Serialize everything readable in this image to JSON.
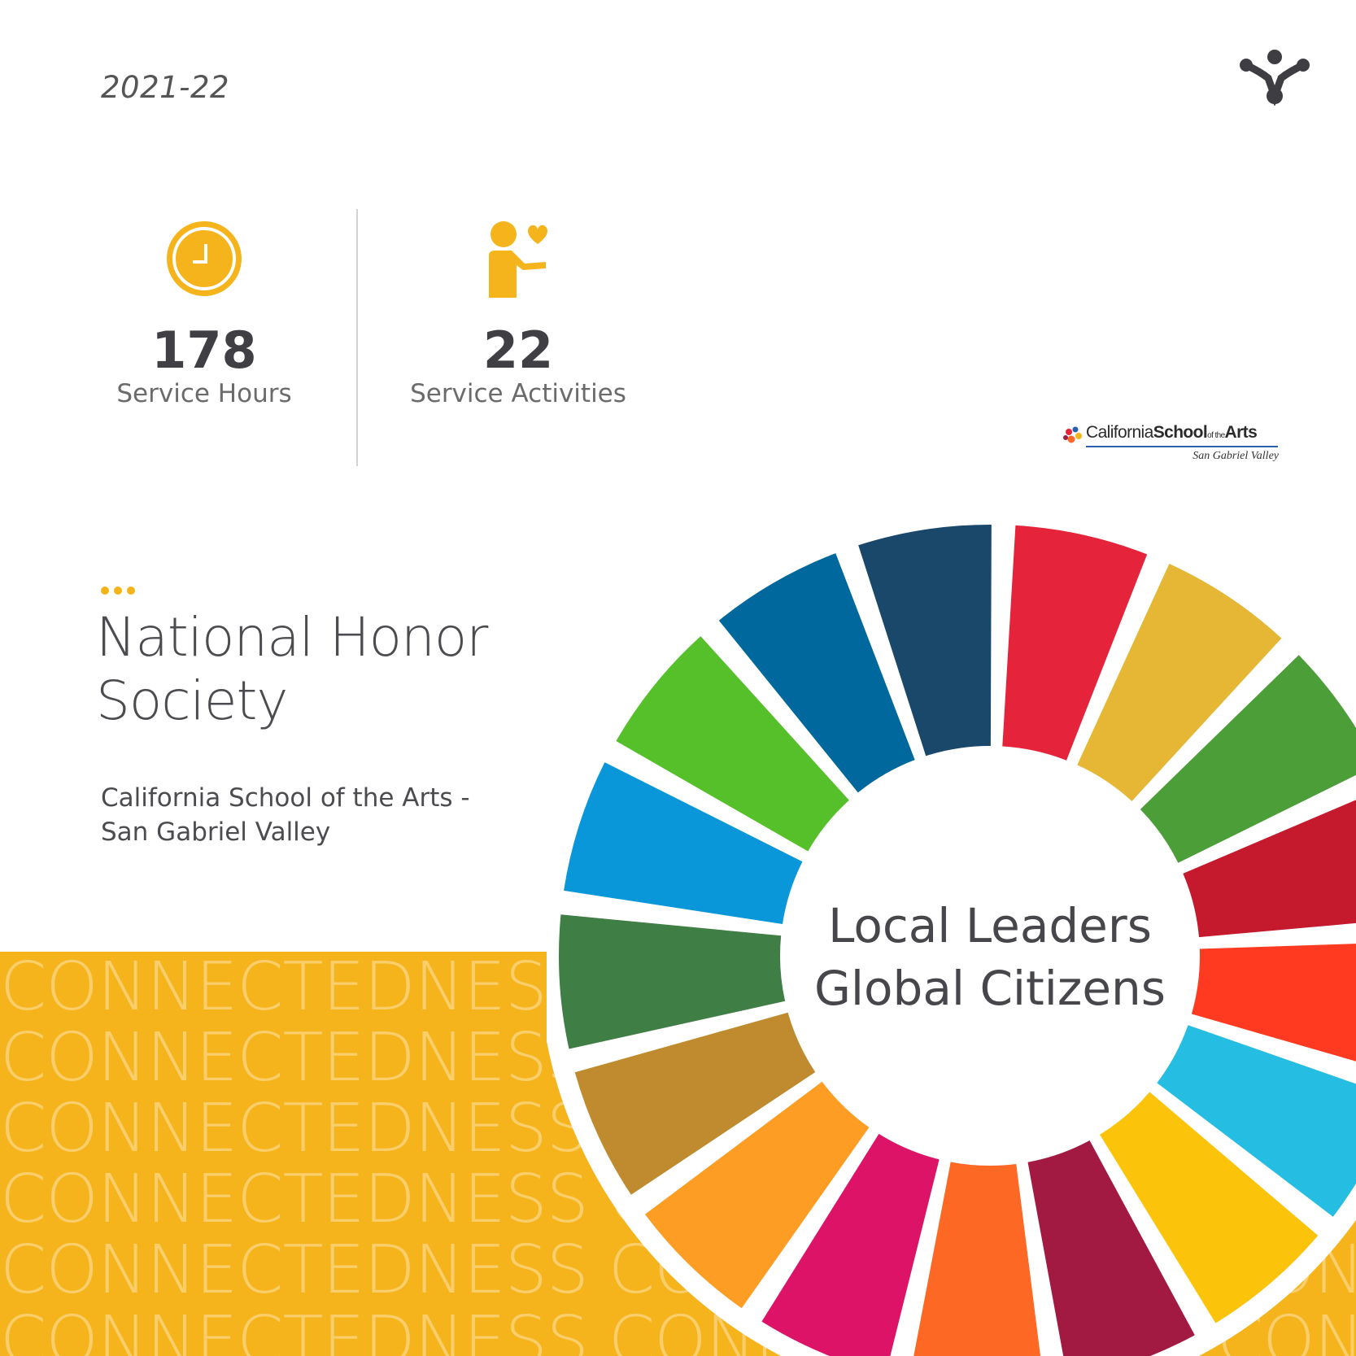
{
  "header": {
    "year": "2021-22",
    "brand_logo": "connect-nodes-logo"
  },
  "stats": [
    {
      "icon": "clock-icon",
      "value": "178",
      "label": "Service Hours"
    },
    {
      "icon": "volunteer-heart-icon",
      "value": "22",
      "label": "Service Activities"
    }
  ],
  "school_logo": {
    "name_part1": "California",
    "name_part2": "School",
    "name_part3": "of the",
    "name_part4": "Arts",
    "tagline": "San Gabriel Valley"
  },
  "organization": {
    "name_line1": "National Honor",
    "name_line2": "Society",
    "school_line1": "California School of the Arts -",
    "school_line2": "San Gabriel Valley"
  },
  "background_word": "CONNECTEDNESS",
  "wheel": {
    "center_line1": "Local Leaders",
    "center_line2": "Global Citizens",
    "colors": [
      "#e5243b",
      "#e5b735",
      "#4c9f38",
      "#c5192d",
      "#ff3a21",
      "#26bde2",
      "#fcc30b",
      "#a21942",
      "#fd6925",
      "#dd1367",
      "#fd9d24",
      "#bf8b2e",
      "#3f7e44",
      "#0a97d9",
      "#56c02b",
      "#00689d",
      "#19486a"
    ]
  },
  "colors": {
    "accent_yellow": "#f6b41c",
    "text_dark": "#4c4c50"
  }
}
